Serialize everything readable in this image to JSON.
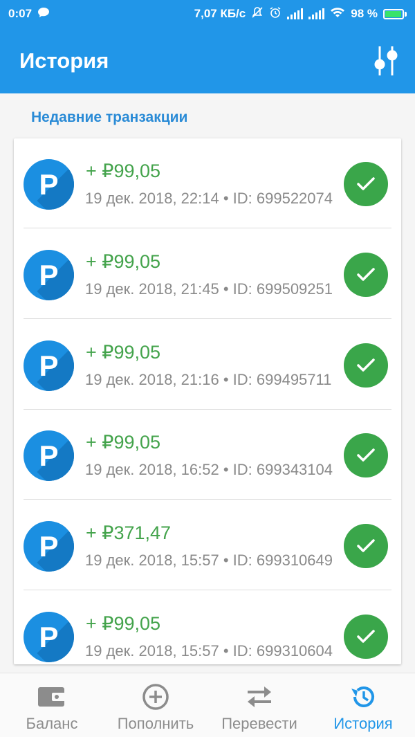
{
  "statusbar": {
    "time": "0:07",
    "net_speed": "7,07 КБ/с",
    "battery": "98 %",
    "battery_level": 0.98
  },
  "appbar": {
    "title": "История"
  },
  "section": {
    "title": "Недавние транзакции"
  },
  "transactions": [
    {
      "amount": "+ ₽99,05",
      "meta": "19 дек. 2018, 22:14 • ID: 699522074",
      "avatar_letter": "P"
    },
    {
      "amount": "+ ₽99,05",
      "meta": "19 дек. 2018, 21:45 • ID: 699509251",
      "avatar_letter": "P"
    },
    {
      "amount": "+ ₽99,05",
      "meta": "19 дек. 2018, 21:16 • ID: 699495711",
      "avatar_letter": "P"
    },
    {
      "amount": "+ ₽99,05",
      "meta": "19 дек. 2018, 16:52 • ID: 699343104",
      "avatar_letter": "P"
    },
    {
      "amount": "+ ₽371,47",
      "meta": "19 дек. 2018, 15:57 • ID: 699310649",
      "avatar_letter": "P"
    },
    {
      "amount": "+ ₽99,05",
      "meta": "19 дек. 2018, 15:57 • ID: 699310604",
      "avatar_letter": "P"
    }
  ],
  "nav": {
    "items": [
      {
        "label": "Баланс",
        "icon": "wallet-icon"
      },
      {
        "label": "Пополнить",
        "icon": "plus-circle-icon"
      },
      {
        "label": "Перевести",
        "icon": "transfer-arrows-icon"
      },
      {
        "label": "История",
        "icon": "history-icon",
        "active": true
      }
    ]
  },
  "colors": {
    "primary": "#2196e8",
    "amount_green": "#43a34b",
    "check_green": "#3aa64a",
    "section_title": "#2a8bd6"
  }
}
